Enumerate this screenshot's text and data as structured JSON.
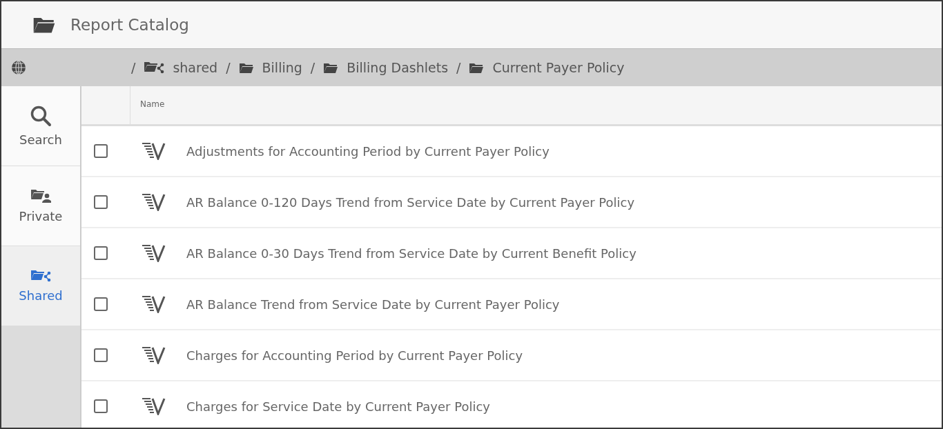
{
  "header": {
    "title": "Report Catalog"
  },
  "breadcrumb": [
    {
      "kind": "shared",
      "separator": "/",
      "label": "shared"
    },
    {
      "kind": "folder",
      "separator": "/",
      "label": "Billing"
    },
    {
      "kind": "folder",
      "separator": "/",
      "label": "Billing Dashlets"
    },
    {
      "kind": "folder",
      "separator": "/",
      "label": "Current Payer Policy"
    }
  ],
  "sidebar": {
    "items": [
      {
        "kind": "search",
        "label": "Search",
        "selected": false
      },
      {
        "kind": "private",
        "label": "Private",
        "selected": false
      },
      {
        "kind": "shared",
        "label": "Shared",
        "selected": true
      }
    ]
  },
  "table": {
    "columns": [
      "Name"
    ],
    "rows": [
      {
        "name": "Adjustments for Accounting Period by Current Payer Policy",
        "checked": false
      },
      {
        "name": "AR Balance 0-120 Days Trend from Service Date by Current Payer Policy",
        "checked": false
      },
      {
        "name": "AR Balance 0-30 Days Trend from Service Date by Current Benefit Policy",
        "checked": false
      },
      {
        "name": "AR Balance Trend from Service Date by Current Payer Policy",
        "checked": false
      },
      {
        "name": "Charges for Accounting Period by Current Payer Policy",
        "checked": false
      },
      {
        "name": "Charges for Service Date by Current Payer Policy",
        "checked": false
      }
    ]
  }
}
